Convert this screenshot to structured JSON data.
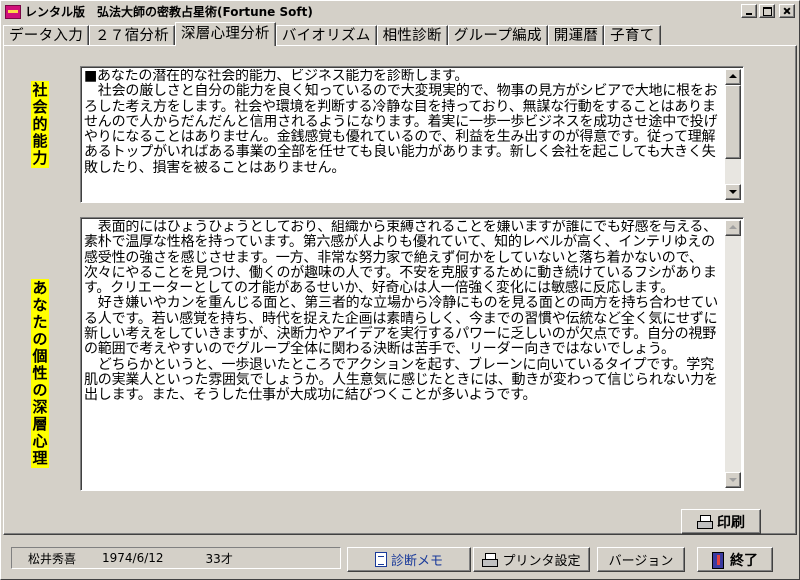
{
  "window": {
    "title": "レンタル版　弘法大師の密教占星術(Fortune Soft)"
  },
  "tabs": [
    {
      "label": "データ入力",
      "active": false
    },
    {
      "label": "２７宿分析",
      "active": false
    },
    {
      "label": "深層心理分析",
      "active": true
    },
    {
      "label": "バイオリズム",
      "active": false
    },
    {
      "label": "相性診断",
      "active": false
    },
    {
      "label": "グループ編成",
      "active": false
    },
    {
      "label": "開運暦",
      "active": false
    },
    {
      "label": "子育て",
      "active": false
    }
  ],
  "sections": {
    "social": {
      "label": "社会的能力",
      "text": "■あなたの潜在的な社会的能力、ビジネス能力を診断します。\n　社会の厳しさと自分の能力を良く知っているので大変現実的で、物事の見方がシビアで大地に根をおろした考え方をします。社会や環境を判断する冷静な目を持っており、無謀な行動をすることはありませんので人からだんだんと信用されるようになります。着実に一歩一歩ビジネスを成功させ途中で投げやりになることはありません。金銭感覚も優れているので、利益を生み出すのが得意です。従って理解あるトップがいればある事業の全部を任せても良い能力があります。新しく会社を起こしても大きく失敗したり、損害を被ることはありません。"
    },
    "personality": {
      "label": "あなたの個性の深層心理",
      "text": "　表面的にはひょうひょうとしており、組織から束縛されることを嫌いますが誰にでも好感を与える、素朴で温厚な性格を持っています。第六感が人よりも優れていて、知的レベルが高く、インテリゆえの感受性の強さを感じさせます。一方、非常な努力家で絶えず何かをしていないと落ち着かないので、次々にやることを見つけ、働くのが趣味の人です。不安を克服するために動き続けているフシがあります。クリエーターとしての才能があるせいか、好奇心は人一倍強く変化には敏感に反応します。\n　好き嫌いやカンを重んじる面と、第三者的な立場から冷静にものを見る面との両方を持ち合わせている人です。若い感覚を持ち、時代を捉えた企画は素晴らしく、今までの習慣や伝統など全く気にせずに新しい考えをしていきますが、決断力やアイデアを実行するパワーに乏しいのが欠点です。自分の視野の範囲で考えやすいのでグループ全体に関わる決断は苦手で、リーダー向きではないでしょう。\n　どちらかというと、一歩退いたところでアクションを起す、ブレーンに向いているタイプです。学究肌の実業人といった雰囲気でしょうか。人生意気に感じたときには、動きが変わって信じられない力を出します。また、そうした仕事が大成功に結びつくことが多いようです。"
    }
  },
  "buttons": {
    "print": "印刷",
    "memo": "診断メモ",
    "printer_settings": "プリンタ設定",
    "version": "バージョン",
    "exit": "終了"
  },
  "status": {
    "name": "松井秀喜",
    "birthdate": "1974/6/12",
    "age": "33才"
  },
  "icons": {
    "app": "app-icon",
    "print": "printer-icon",
    "memo": "memo-icon",
    "printer_settings": "printer-icon",
    "exit": "exit-door-icon"
  },
  "colors": {
    "label_highlight": "#ffff00",
    "memo_text": "#1a3a9a"
  }
}
